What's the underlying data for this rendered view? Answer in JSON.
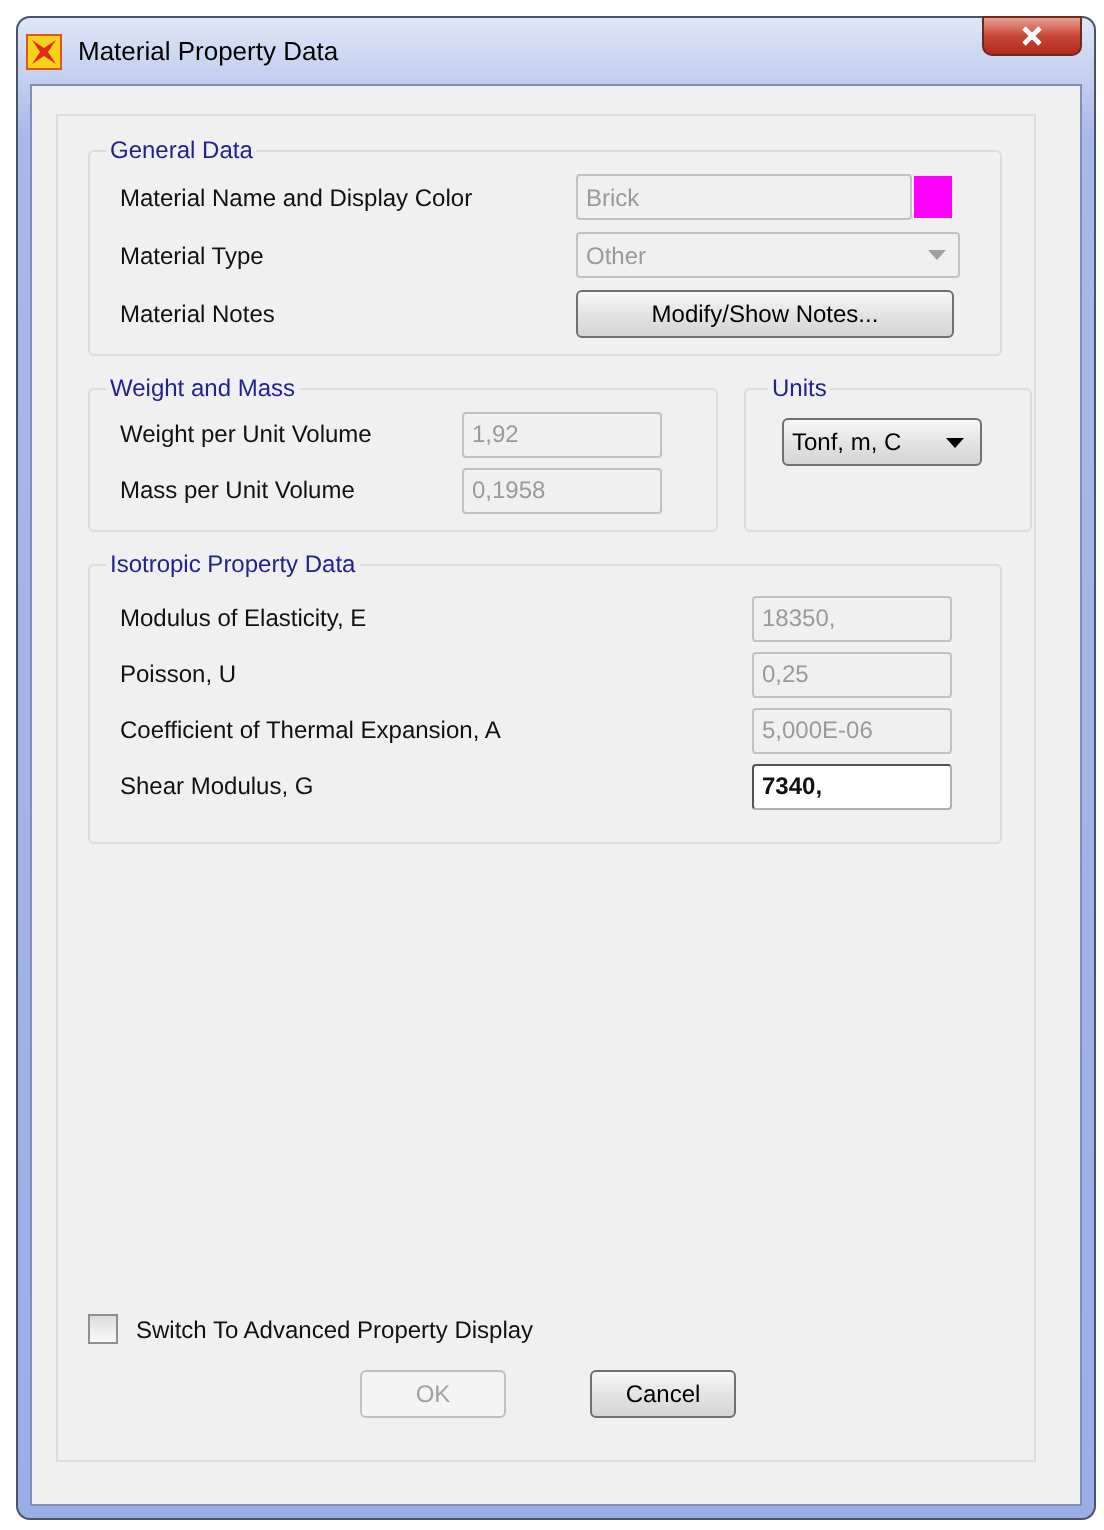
{
  "window": {
    "title": "Material Property Data"
  },
  "general_data": {
    "title": "General Data",
    "rows": [
      {
        "kind": "text",
        "label": "Material Name and Display Color",
        "value": "Brick",
        "disabled": true,
        "color": "#ff00ff"
      },
      {
        "kind": "dropdown",
        "label": "Material Type",
        "value": "Other",
        "disabled": true
      },
      {
        "kind": "button",
        "label": "Material Notes",
        "value": "Modify/Show Notes...",
        "disabled": false
      }
    ]
  },
  "weight_and_mass": {
    "title": "Weight and Mass",
    "rows": [
      {
        "label": "Weight per Unit Volume",
        "value": "1,92",
        "disabled": true
      },
      {
        "label": "Mass per Unit Volume",
        "value": "0,1958",
        "disabled": true
      }
    ]
  },
  "units": {
    "title": "Units",
    "value": "Tonf, m, C",
    "disabled": false
  },
  "isotropic_property_data": {
    "title": "Isotropic Property Data",
    "rows": [
      {
        "label": "Modulus of Elasticity,  E",
        "value": "18350,",
        "disabled": true
      },
      {
        "label": "Poisson, U",
        "value": "0,25",
        "disabled": true
      },
      {
        "label": "Coefficient of Thermal Expansion,  A",
        "value": "5,000E-06",
        "disabled": true
      },
      {
        "label": "Shear Modulus,  G",
        "value": "7340,",
        "disabled": false
      }
    ]
  },
  "advanced_display": {
    "label": "Switch To Advanced Property Display",
    "checked": false
  },
  "buttons": [
    {
      "label": "OK",
      "disabled": true
    },
    {
      "label": "Cancel",
      "disabled": false
    }
  ]
}
